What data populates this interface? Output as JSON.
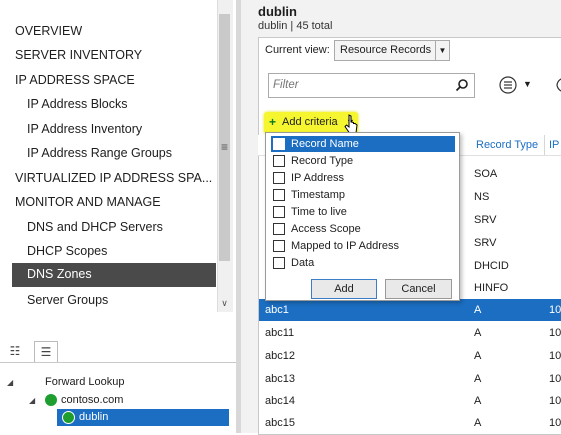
{
  "nav": {
    "items": [
      {
        "label": "OVERVIEW"
      },
      {
        "label": "SERVER INVENTORY"
      },
      {
        "label": "IP ADDRESS SPACE"
      },
      {
        "label": "IP Address Blocks"
      },
      {
        "label": "IP Address Inventory"
      },
      {
        "label": "IP Address Range Groups"
      },
      {
        "label": "VIRTUALIZED IP ADDRESS SPA..."
      },
      {
        "label": "MONITOR AND MANAGE"
      },
      {
        "label": "DNS and DHCP Servers"
      },
      {
        "label": "DHCP Scopes"
      },
      {
        "label": "DNS Zones"
      },
      {
        "label": "Server Groups"
      }
    ],
    "selected": "DNS Zones"
  },
  "tree": {
    "items": [
      {
        "label": "Forward Lookup"
      },
      {
        "label": "contoso.com"
      },
      {
        "label": "dublin"
      }
    ]
  },
  "content": {
    "title": "dublin",
    "subtitle": "dublin | 45 total",
    "current_view_label": "Current view:",
    "current_view_value": "Resource Records",
    "filter_placeholder": "Filter",
    "add_criteria_label": "Add criteria",
    "columns": [
      {
        "label": "Record Type"
      },
      {
        "label": "IP"
      }
    ],
    "rows": [
      {
        "name": "",
        "type": "SOA",
        "ip": ""
      },
      {
        "name": "",
        "type": "NS",
        "ip": ""
      },
      {
        "name": "",
        "type": "SRV",
        "ip": ""
      },
      {
        "name": "",
        "type": "SRV",
        "ip": ""
      },
      {
        "name": "",
        "type": "DHCID",
        "ip": ""
      },
      {
        "name": "",
        "type": "HINFO",
        "ip": ""
      },
      {
        "name": "abc1",
        "type": "A",
        "ip": "10"
      },
      {
        "name": "abc11",
        "type": "A",
        "ip": "10"
      },
      {
        "name": "abc12",
        "type": "A",
        "ip": "10"
      },
      {
        "name": "abc13",
        "type": "A",
        "ip": "10"
      },
      {
        "name": "abc14",
        "type": "A",
        "ip": "10"
      },
      {
        "name": "abc15",
        "type": "A",
        "ip": "10"
      }
    ],
    "selected_row": "abc1"
  },
  "criteria_dropdown": {
    "items": [
      {
        "label": "Record Name"
      },
      {
        "label": "Record Type"
      },
      {
        "label": "IP Address"
      },
      {
        "label": "Timestamp"
      },
      {
        "label": "Time to live"
      },
      {
        "label": "Access Scope"
      },
      {
        "label": "Mapped to IP Address"
      },
      {
        "label": "Data"
      }
    ],
    "highlighted": "Record Name",
    "add_label": "Add",
    "cancel_label": "Cancel"
  },
  "colors": {
    "selection_blue": "#1b6ec2",
    "nav_selected": "#4a4a4a",
    "highlight_yellow": "#f6f630",
    "status_green": "#1e9e2e"
  }
}
